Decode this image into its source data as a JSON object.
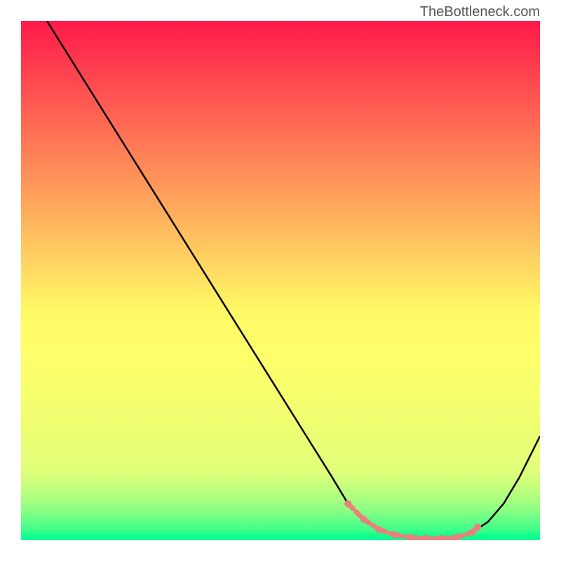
{
  "watermark": "TheBottleneck.com",
  "chart_data": {
    "type": "line",
    "title": "",
    "xlabel": "",
    "ylabel": "",
    "xlim": [
      0,
      100
    ],
    "ylim": [
      0,
      100
    ],
    "curve": {
      "x": [
        5,
        10,
        15,
        20,
        25,
        30,
        35,
        40,
        45,
        50,
        55,
        60,
        63,
        66,
        69,
        72,
        75,
        78,
        81,
        84,
        87,
        90,
        93,
        96,
        100
      ],
      "y": [
        100,
        92,
        84,
        76,
        68,
        60,
        52,
        44,
        36,
        28,
        20,
        12,
        7,
        4,
        2,
        1,
        0.5,
        0.3,
        0.3,
        0.5,
        1.5,
        3.5,
        7,
        12,
        20
      ]
    },
    "markers": {
      "x": [
        63,
        66,
        69,
        72,
        75,
        78,
        81,
        84,
        87,
        88
      ],
      "y": [
        7,
        4,
        2,
        1,
        0.5,
        0.3,
        0.3,
        0.5,
        1.5,
        2.5
      ],
      "style": "dashed-salmon"
    },
    "background": {
      "type": "vertical-gradient",
      "stops": [
        {
          "pos": 0,
          "color": "#ff1a4a"
        },
        {
          "pos": 50,
          "color": "#ffda62"
        },
        {
          "pos": 80,
          "color": "#efff72"
        },
        {
          "pos": 100,
          "color": "#00ff92"
        }
      ]
    }
  }
}
